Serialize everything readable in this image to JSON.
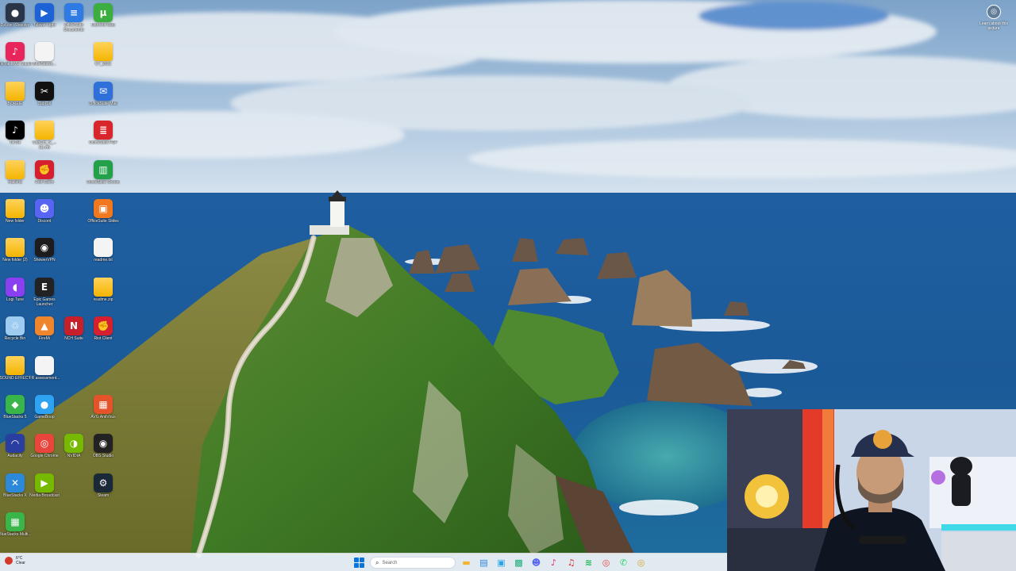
{
  "desktop": {
    "icons": [
      {
        "label": "DaVinci Resolve",
        "icon": "davinci-icon",
        "glyph": "●",
        "color": "#2b3548"
      },
      {
        "label": "Televzr Light",
        "icon": "televzr-icon",
        "glyph": "▶",
        "color": "#1e63d6"
      },
      {
        "label": "OfficeSuite Documents",
        "icon": "officesuite-documents-icon",
        "glyph": "≡",
        "color": "#2f7be4"
      },
      {
        "label": "Utorrent Web",
        "icon": "utorrent-icon",
        "glyph": "µ",
        "color": "#3cae3f"
      },
      {
        "label": "TikTok LIVE Studio",
        "icon": "tiktok-live-icon",
        "glyph": "♪",
        "color": "#e8265c"
      },
      {
        "label": "BlueStacks...",
        "icon": "file-icon",
        "glyph": "",
        "color": "#f4f4f4"
      },
      {
        "label": "CT_2021",
        "icon": "folder-icon",
        "glyph": "",
        "color": "#f4b400"
      },
      {
        "label": "BOREIE",
        "icon": "folder-icon",
        "glyph": "",
        "color": "#f4b400"
      },
      {
        "label": "CapCut",
        "icon": "capcut-icon",
        "glyph": "✂",
        "color": "#111111"
      },
      {
        "label": "OfficeSuite Mail",
        "icon": "officesuite-mail-icon",
        "glyph": "✉",
        "color": "#2e6fd9"
      },
      {
        "label": "TikTok",
        "icon": "tiktok-icon",
        "glyph": "♪",
        "color": "#000000"
      },
      {
        "label": "CapCut_S_... (1).zip",
        "icon": "zip-folder-icon",
        "glyph": "",
        "color": "#f4b400"
      },
      {
        "label": "OfficeSuite PDF",
        "icon": "officesuite-pdf-icon",
        "glyph": "≣",
        "color": "#d8262c"
      },
      {
        "label": "malleria",
        "icon": "folder-icon",
        "glyph": "",
        "color": "#f4b400"
      },
      {
        "label": "Riot Client",
        "icon": "riot-client-icon",
        "glyph": "✊",
        "color": "#d6202f"
      },
      {
        "label": "OfficeSuite Sheets",
        "icon": "officesuite-sheets-icon",
        "glyph": "▥",
        "color": "#23a14a"
      },
      {
        "label": "New folder",
        "icon": "folder-icon",
        "glyph": "",
        "color": "#f4b400"
      },
      {
        "label": "Discord",
        "icon": "discord-icon",
        "glyph": "☻",
        "color": "#5865f2"
      },
      {
        "label": "OfficeSuite Slides",
        "icon": "officesuite-slides-icon",
        "glyph": "▣",
        "color": "#f1781e"
      },
      {
        "label": "New folder (2)",
        "icon": "folder-icon",
        "glyph": "",
        "color": "#f4b400"
      },
      {
        "label": "ShowerVPN",
        "icon": "vpn-icon",
        "glyph": "◉",
        "color": "#1c1c1c"
      },
      {
        "label": "readme.txt",
        "icon": "text-file-icon",
        "glyph": "",
        "color": "#f4f4f4"
      },
      {
        "label": "Logi Tune",
        "icon": "logi-tune-icon",
        "glyph": "◖",
        "color": "#8a3ff0"
      },
      {
        "label": "Epic Games Launcher",
        "icon": "epic-games-icon",
        "glyph": "E",
        "color": "#222222"
      },
      {
        "label": "readme.zip",
        "icon": "zip-folder-icon",
        "glyph": "",
        "color": "#f4b400"
      },
      {
        "label": "Recycle Bin",
        "icon": "recycle-bin-icon",
        "glyph": "♲",
        "color": "#9ecbf0"
      },
      {
        "label": "FireMi",
        "icon": "firemi-icon",
        "glyph": "▲",
        "color": "#f0862b"
      },
      {
        "label": "NCH Suite",
        "icon": "nch-suite-icon",
        "glyph": "N",
        "color": "#c8202a"
      },
      {
        "label": "Riot Client",
        "icon": "riot-client-icon",
        "glyph": "✊",
        "color": "#d6202f"
      },
      {
        "label": "SOUND EFFECT",
        "icon": "folder-icon",
        "glyph": "",
        "color": "#f4b400"
      },
      {
        "label": "FR assessment...",
        "icon": "document-icon",
        "glyph": "",
        "color": "#f4f4f4"
      },
      {
        "label": "BlueStacks 5",
        "icon": "bluestacks-icon",
        "glyph": "◆",
        "color": "#39b54a"
      },
      {
        "label": "GameBoop",
        "icon": "gameboop-icon",
        "glyph": "●",
        "color": "#2ea3f2"
      },
      {
        "label": "AVG AntiVirus",
        "icon": "avg-icon",
        "glyph": "▦",
        "color": "#e5532a"
      },
      {
        "label": "Audacity",
        "icon": "audacity-icon",
        "glyph": "◠",
        "color": "#2a3ea1"
      },
      {
        "label": "Google Chrome",
        "icon": "chrome-icon",
        "glyph": "◎",
        "color": "#e8453c"
      },
      {
        "label": "NVIDIA",
        "icon": "nvidia-icon",
        "glyph": "◑",
        "color": "#76b900"
      },
      {
        "label": "OBS Studio",
        "icon": "obs-icon",
        "glyph": "◉",
        "color": "#222222"
      },
      {
        "label": "BlueStacks X",
        "icon": "bluestacks-x-icon",
        "glyph": "✕",
        "color": "#2c88d9"
      },
      {
        "label": "Nvidia Broadcast",
        "icon": "nvidia-broadcast-icon",
        "glyph": "▶",
        "color": "#76b900"
      },
      {
        "label": "Steam",
        "icon": "steam-icon",
        "glyph": "⚙",
        "color": "#1b2838"
      },
      {
        "label": "BlueStacks Multi...",
        "icon": "bluestacks-multi-icon",
        "glyph": "▦",
        "color": "#39b54a"
      }
    ]
  },
  "widget": {
    "label": "Learn about this picture"
  },
  "taskbar": {
    "weather_temp": "6°C",
    "weather_desc": "Clear",
    "search_placeholder": "Search",
    "apps": [
      {
        "name": "file-explorer-icon",
        "glyph": "▬",
        "color": "#f3b52b"
      },
      {
        "name": "store-icon",
        "glyph": "▤",
        "color": "#2b7fe0"
      },
      {
        "name": "capture-icon",
        "glyph": "▣",
        "color": "#2aa6e8"
      },
      {
        "name": "photos-icon",
        "glyph": "▩",
        "color": "#1cae78"
      },
      {
        "name": "discord-icon",
        "glyph": "☻",
        "color": "#5865f2"
      },
      {
        "name": "tiktok-live-icon",
        "glyph": "♪",
        "color": "#e8265c"
      },
      {
        "name": "music-icon",
        "glyph": "♫",
        "color": "#d02a2a"
      },
      {
        "name": "spotify-icon",
        "glyph": "≋",
        "color": "#1db954"
      },
      {
        "name": "chrome-icon",
        "glyph": "◎",
        "color": "#e8453c"
      },
      {
        "name": "whatsapp-icon",
        "glyph": "✆",
        "color": "#25d366"
      },
      {
        "name": "chrome-alt-icon",
        "glyph": "◎",
        "color": "#d9a32b"
      }
    ]
  }
}
